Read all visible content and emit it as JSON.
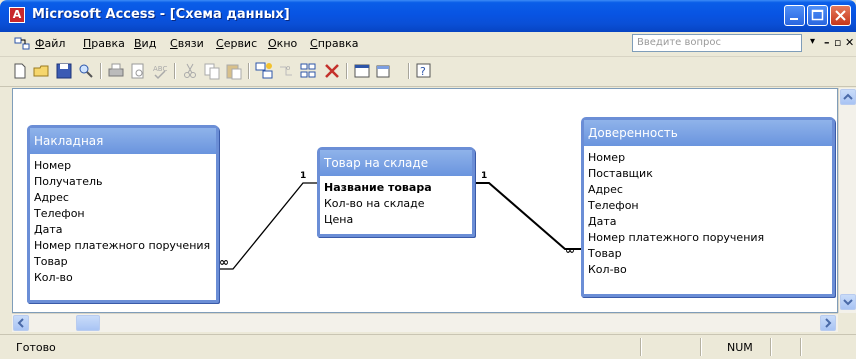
{
  "window": {
    "title": "Microsoft Access - [Схема данных]"
  },
  "menu": [
    {
      "label": "Файл",
      "accel": "Ф",
      "rest": "айл"
    },
    {
      "label": "Правка",
      "accel": "П",
      "rest": "равка"
    },
    {
      "label": "Вид",
      "accel": "В",
      "rest": "ид"
    },
    {
      "label": "Связи",
      "accel": "С",
      "rest": "вязи"
    },
    {
      "label": "Сервис",
      "accel": "С",
      "rest": "ервис"
    },
    {
      "label": "Окно",
      "accel": "О",
      "rest": "кно"
    },
    {
      "label": "Справка",
      "accel": "С",
      "rest": "правка"
    }
  ],
  "help_box": {
    "placeholder": "Введите вопрос"
  },
  "tables": {
    "nakladnaya": {
      "title": "Накладная",
      "fields": [
        "Номер",
        "Получатель",
        "Адрес",
        "Телефон",
        "Дата",
        "Номер платежного поручения",
        "Товар",
        "Кол-во"
      ]
    },
    "tovar": {
      "title": "Товар на складе",
      "key_field": "Название товара",
      "fields": [
        "Кол-во на складе",
        "Цена"
      ]
    },
    "doverennost": {
      "title": "Доверенность",
      "fields": [
        "Номер",
        "Поставщик",
        "Адрес",
        "Телефон",
        "Дата",
        "Номер платежного поручения",
        "Товар",
        "Кол-во"
      ]
    }
  },
  "relations": {
    "left_one": "1",
    "left_many": "∞",
    "right_one": "1",
    "right_many": "∞"
  },
  "status": {
    "text": "Готово",
    "num": "NUM"
  },
  "colors": {
    "title_blue": "#0a5ee8",
    "table_border": "#6b8ed6",
    "face": "#ece9d8"
  }
}
